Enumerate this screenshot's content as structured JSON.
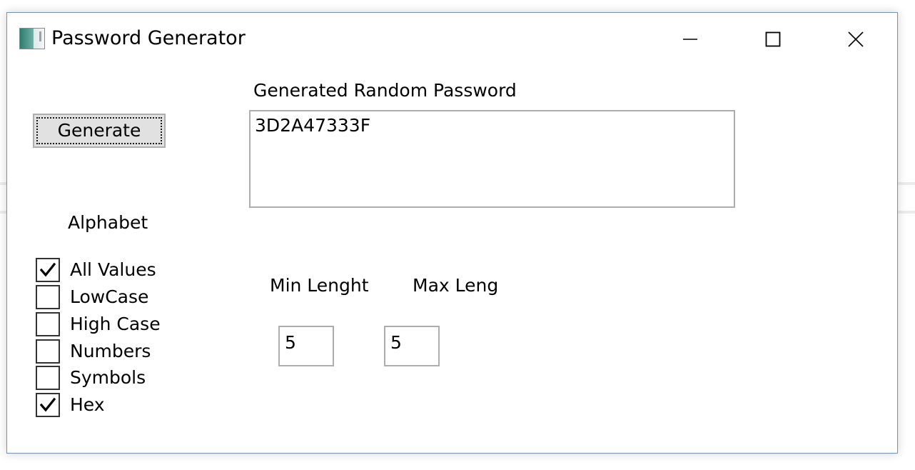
{
  "window": {
    "title": "Password Generator",
    "minimize_glyph": "minimize-icon",
    "maximize_glyph": "maximize-icon",
    "close_glyph": "close-icon",
    "border_color": "#5a9bd5"
  },
  "generate": {
    "label": "Generate"
  },
  "password": {
    "label": "Generated Random Password",
    "value": "3D2A47333F"
  },
  "alphabet": {
    "label": "Alphabet",
    "options": [
      {
        "label": "All Values",
        "checked": true
      },
      {
        "label": "LowCase",
        "checked": false
      },
      {
        "label": "High Case",
        "checked": false
      },
      {
        "label": "Numbers",
        "checked": false
      },
      {
        "label": "Symbols",
        "checked": false
      },
      {
        "label": "Hex",
        "checked": true
      }
    ]
  },
  "length": {
    "min_label": "Min Lenght",
    "max_label": "Max Leng",
    "min_value": "5",
    "max_value": "5"
  }
}
